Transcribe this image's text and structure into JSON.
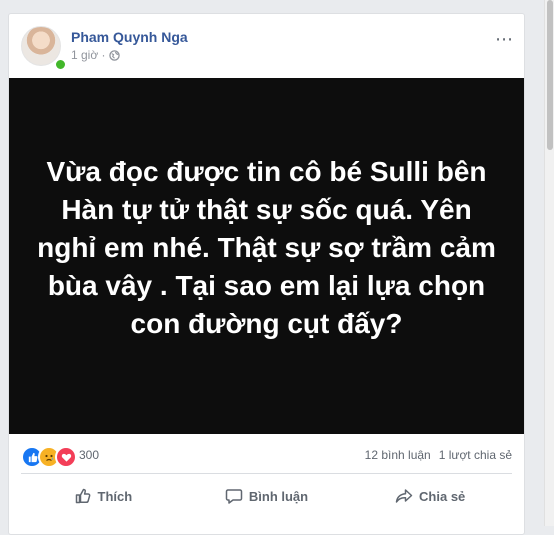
{
  "post": {
    "author": "Pham Quynh Nga",
    "time": "1 giờ ·",
    "text": "Vừa đọc được tin cô bé Sulli bên Hàn tự tử thật sự sốc quá. Yên nghỉ em nhé. Thật sự sợ trầm cảm bùa vây . Tại sao em lại lựa chọn con đường cụt đấy?",
    "more_icon": "⋯"
  },
  "stats": {
    "reaction_count": "300",
    "comments": "12 bình luận",
    "shares": "1 lượt chia sẻ",
    "reactions": [
      "like-icon",
      "sad-icon",
      "love-icon"
    ]
  },
  "actions": {
    "like": "Thích",
    "comment": "Bình luận",
    "share": "Chia sẻ"
  },
  "colors": {
    "author_link": "#365899",
    "image_bg": "#0d0d0d",
    "online": "#42b72a",
    "like": "#1877f2",
    "love": "#f33e58",
    "sad": "#f7b125"
  }
}
